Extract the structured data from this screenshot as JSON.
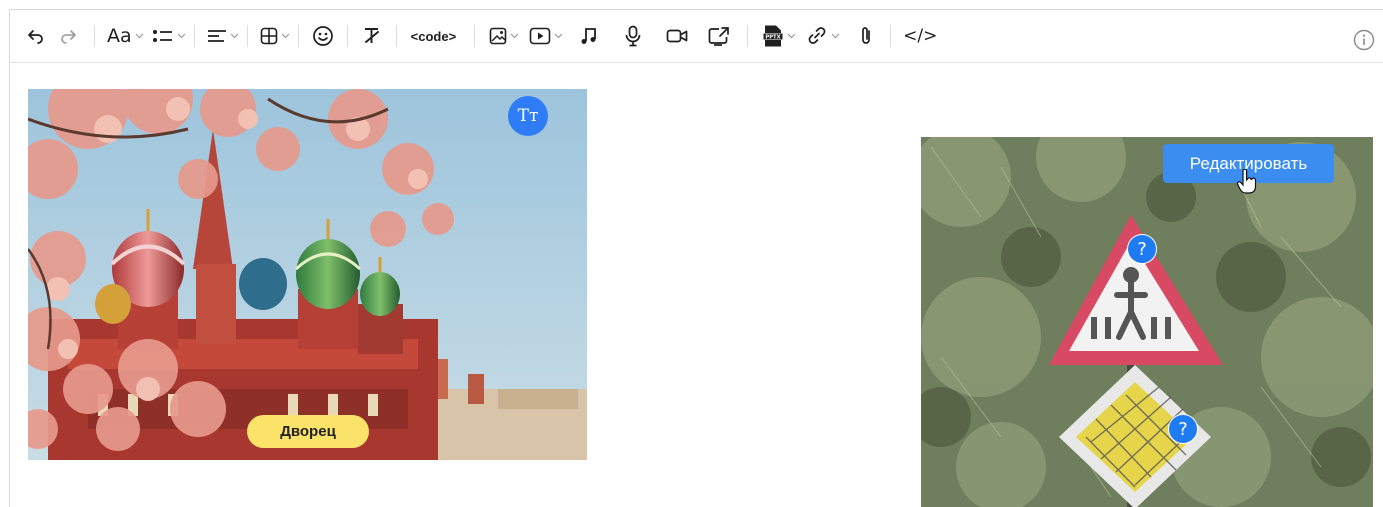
{
  "toolbar": {
    "undo_icon": "undo-icon",
    "redo_icon": "redo-icon",
    "font_label": "Aa",
    "code_label": "<code>",
    "html_label": "</>",
    "caret_glyph": "⌄"
  },
  "images": {
    "left": {
      "tt_badge": "Tт",
      "label": "Дворец"
    },
    "right": {
      "edit_button": "Редактировать",
      "marker_1": "?",
      "marker_2": "?"
    }
  },
  "colors": {
    "accent_blue": "#2f7df6",
    "label_yellow": "#fbe36a",
    "edit_button_blue": "#3b8ef0"
  }
}
